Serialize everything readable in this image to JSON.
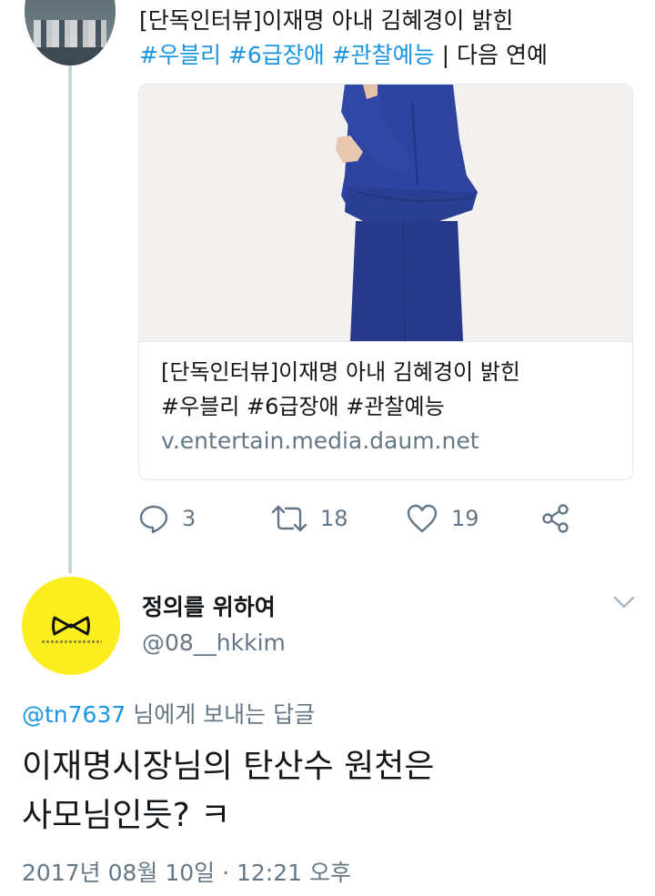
{
  "tweet1": {
    "text_line1": "[단독인터뷰]이재명 아내 김혜경이 밝힌",
    "hashtags": [
      "#우블리",
      "#6급장애",
      "#관찰예능"
    ],
    "suffix": "| 다음 연예",
    "card": {
      "title_line1": "[단독인터뷰]이재명 아내 김혜경이 밝힌",
      "title_line2": "#우블리 #6급장애 #관찰예능",
      "domain": "v.entertain.media.daum.net"
    },
    "actions": {
      "reply_count": "3",
      "retweet_count": "18",
      "like_count": "19"
    }
  },
  "tweet2": {
    "display_name": "정의를 위하여",
    "handle": "@08__hkkim",
    "reply_mention": "@tn7637",
    "reply_suffix": " 님에게 보내는 답글",
    "text_line1": "이재명시장님의 탄산수 원천은",
    "text_line2": "사모님인듯? ㅋ",
    "timestamp": "2017년 08월 10일 · 12:21 오후"
  },
  "colors": {
    "link": "#1b95e0",
    "secondary": "#657786",
    "avatar_yellow": "#fbed1e",
    "dress_blue": "#2a3f93"
  },
  "icons": [
    "reply-icon",
    "retweet-icon",
    "like-icon",
    "share-icon",
    "chevron-down-icon",
    "ribbon-logo-icon"
  ]
}
